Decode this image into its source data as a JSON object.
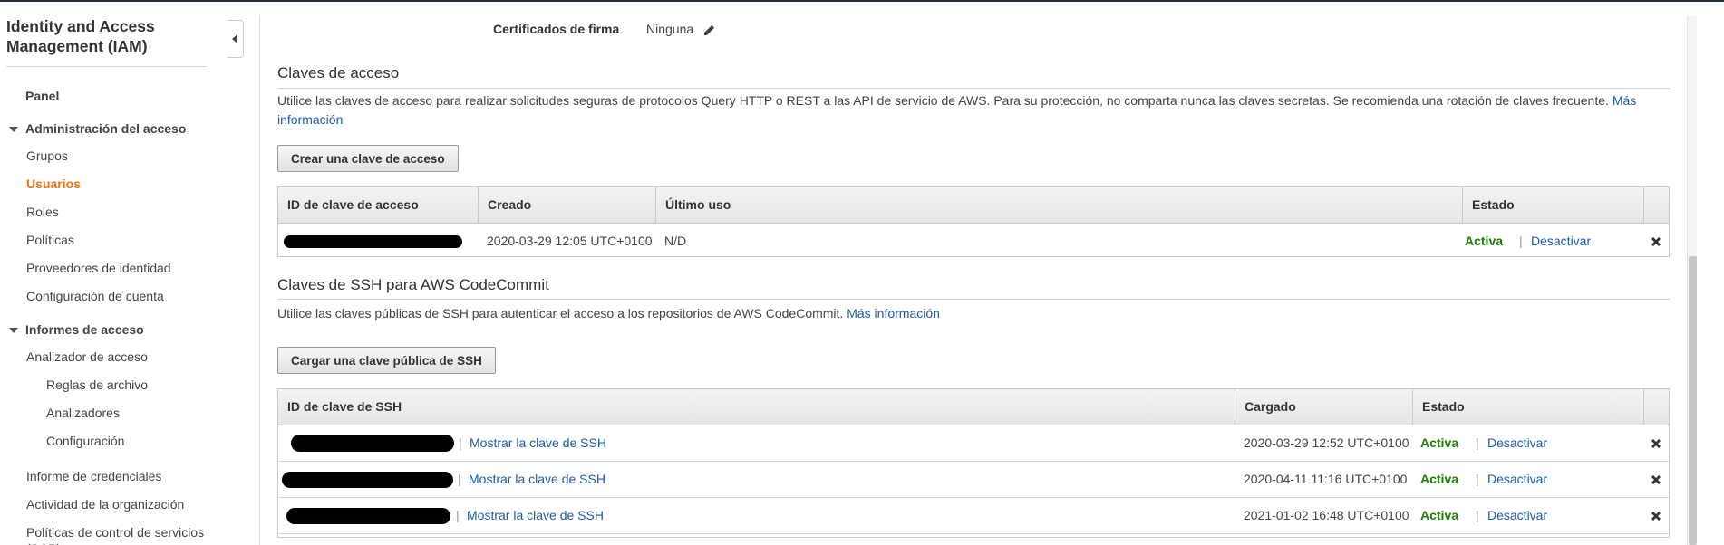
{
  "sidebar": {
    "title": "Identity and Access Management (IAM)",
    "panel": "Panel",
    "access_mgmt": {
      "header": "Administración del acceso",
      "items": [
        "Grupos",
        "Usuarios",
        "Roles",
        "Políticas",
        "Proveedores de identidad",
        "Configuración de cuenta"
      ]
    },
    "access_reports": {
      "header": "Informes de acceso",
      "analyzer": "Analizador de acceso",
      "analyzer_items": [
        "Reglas de archivo",
        "Analizadores",
        "Configuración"
      ],
      "items": [
        "Informe de credenciales",
        "Actividad de la organización",
        "Políticas de control de servicios (SCP)"
      ]
    }
  },
  "signing": {
    "label": "Certificados de firma",
    "value": "Ninguna"
  },
  "access_keys": {
    "title": "Claves de acceso",
    "description": "Utilice las claves de acceso para realizar solicitudes seguras de protocolos Query HTTP o REST a las API de servicio de AWS. Para su protección, no comparta nunca las claves secretas. Se recomienda una rotación de claves frecuente.",
    "more_info": "Más información",
    "create_button": "Crear una clave de acceso",
    "headers": [
      "ID de clave de acceso",
      "Creado",
      "Último uso",
      "Estado"
    ],
    "rows": [
      {
        "created": "2020-03-29 12:05 UTC+0100",
        "last_used": "N/D",
        "status": "Activa",
        "action": "Desactivar"
      }
    ]
  },
  "ssh_keys": {
    "title": "Claves de SSH para AWS CodeCommit",
    "description": "Utilice las claves públicas de SSH para autenticar el acceso a los repositorios de AWS CodeCommit.",
    "more_info": "Más información",
    "upload_button": "Cargar una clave pública de SSH",
    "headers": [
      "ID de clave de SSH",
      "Cargado",
      "Estado"
    ],
    "show_key": "Mostrar la clave de SSH",
    "rows": [
      {
        "uploaded": "2020-03-29 12:52 UTC+0100",
        "status": "Activa",
        "action": "Desactivar"
      },
      {
        "uploaded": "2020-04-11 11:16 UTC+0100",
        "status": "Activa",
        "action": "Desactivar"
      },
      {
        "uploaded": "2021-01-02 16:48 UTC+0100",
        "status": "Activa",
        "action": "Desactivar"
      }
    ]
  },
  "colors": {
    "accent": "#ec7211",
    "link": "#1f5aa8",
    "active": "#1d8102"
  }
}
